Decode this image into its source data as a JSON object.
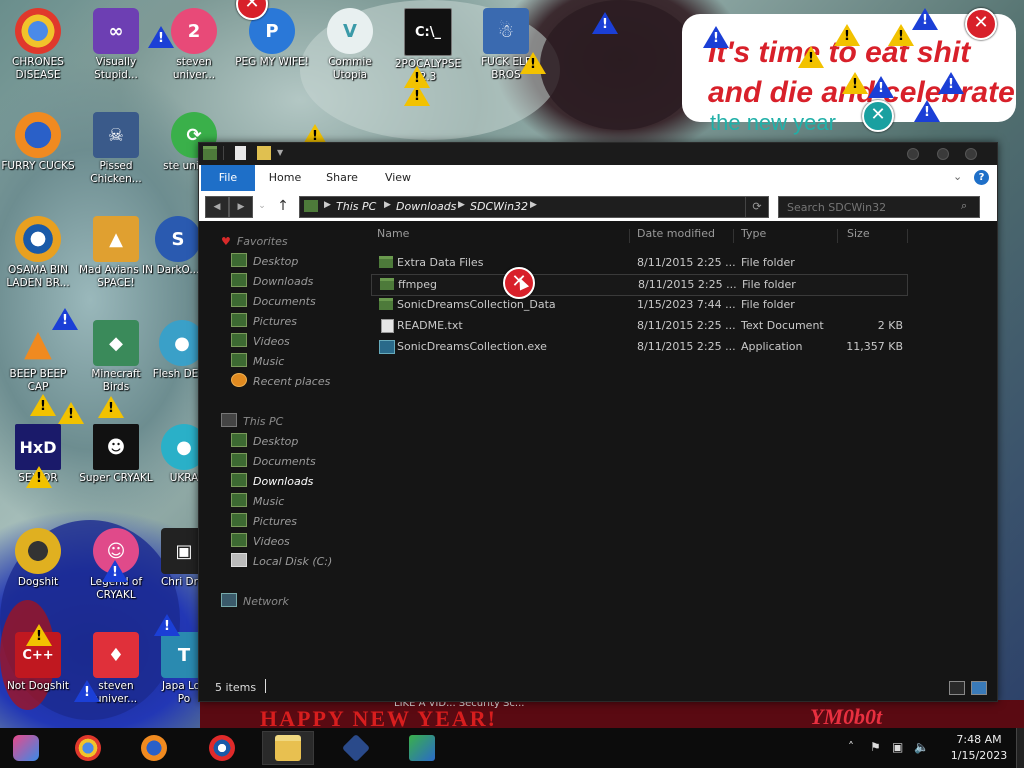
{
  "desktop": {
    "icons": [
      {
        "label": "CHRONES DISEASE"
      },
      {
        "label": "Visually Stupid..."
      },
      {
        "label": "steven univer..."
      },
      {
        "label": "PEG MY WIFE!"
      },
      {
        "label": "Commie Utopia"
      },
      {
        "label": "2POCALYPSE 2.3"
      },
      {
        "label": "FUCK ELF BROS"
      },
      {
        "label": "FURRY CUCKS"
      },
      {
        "label": "Pissed Chicken..."
      },
      {
        "label": "ste univer..."
      },
      {
        "label": "OSAMA BIN LADEN BR..."
      },
      {
        "label": "Mad Avians IN SPACE!"
      },
      {
        "label": "DarkO..."
      },
      {
        "label": "BEEP BEEP CAP"
      },
      {
        "label": "Minecraft Birds"
      },
      {
        "label": "Flesh DELU"
      },
      {
        "label": "SEX OR"
      },
      {
        "label": "Super CRYAKL"
      },
      {
        "label": "UKRA"
      },
      {
        "label": "Dogshit"
      },
      {
        "label": "Legend of CRYAKL"
      },
      {
        "label": "Chri Droi"
      },
      {
        "label": "Not Dogshit"
      },
      {
        "label": "steven univer..."
      },
      {
        "label": "Japa Loli Po"
      }
    ],
    "banner_lines": [
      "It's time to eat shit",
      "and die and celebrate",
      "the new year"
    ],
    "bottom_strip_text": "HAPPY NEW YEAR!",
    "bottom_strip_right": "YM0b0t",
    "behind_window_labels": "LIKE A VID...    Security Sc..."
  },
  "explorer": {
    "ribbon_tabs": [
      "File",
      "Home",
      "Share",
      "View"
    ],
    "help_icon_label": "?",
    "breadcrumb": [
      "This PC",
      "Downloads",
      "SDCWin32"
    ],
    "search_placeholder": "Search SDCWin32",
    "nav": {
      "favorites_label": "Favorites",
      "favorites": [
        "Desktop",
        "Downloads",
        "Documents",
        "Pictures",
        "Videos",
        "Music",
        "Recent places"
      ],
      "thispc_label": "This PC",
      "thispc": [
        "Desktop",
        "Documents",
        "Downloads",
        "Music",
        "Pictures",
        "Videos",
        "Local Disk (C:)"
      ],
      "network_label": "Network",
      "selected": "Downloads"
    },
    "columns": [
      "Name",
      "Date modified",
      "Type",
      "Size"
    ],
    "files": [
      {
        "name": "Extra Data Files",
        "date": "8/11/2015 2:25 ...",
        "type": "File folder",
        "size": "",
        "kind": "folder"
      },
      {
        "name": "ffmpeg",
        "date": "8/11/2015 2:25 ...",
        "type": "File folder",
        "size": "",
        "kind": "folder",
        "selected": true
      },
      {
        "name": "SonicDreamsCollection_Data",
        "date": "1/15/2023 7:44 ...",
        "type": "File folder",
        "size": "",
        "kind": "folder"
      },
      {
        "name": "README.txt",
        "date": "8/11/2015 2:25 ...",
        "type": "Text Document",
        "size": "2 KB",
        "kind": "text"
      },
      {
        "name": "SonicDreamsCollection.exe",
        "date": "8/11/2015 2:25 ...",
        "type": "Application",
        "size": "11,357 KB",
        "kind": "exe"
      }
    ],
    "status": "5 items"
  },
  "taskbar": {
    "clock_time": "7:48 AM",
    "clock_date": "1/15/2023",
    "pinned": [
      "firefox-nightly-icon",
      "chrome-icon",
      "firefox-icon",
      "obama-icon",
      "file-explorer-icon",
      "game-launcher-icon",
      "network-people-icon"
    ]
  },
  "colors": {
    "accent": "#1e6fc8",
    "window_bg": "#151515",
    "error_red": "#d8202a",
    "warning_yellow": "#f2c200",
    "info_blue": "#1b3fd6"
  }
}
